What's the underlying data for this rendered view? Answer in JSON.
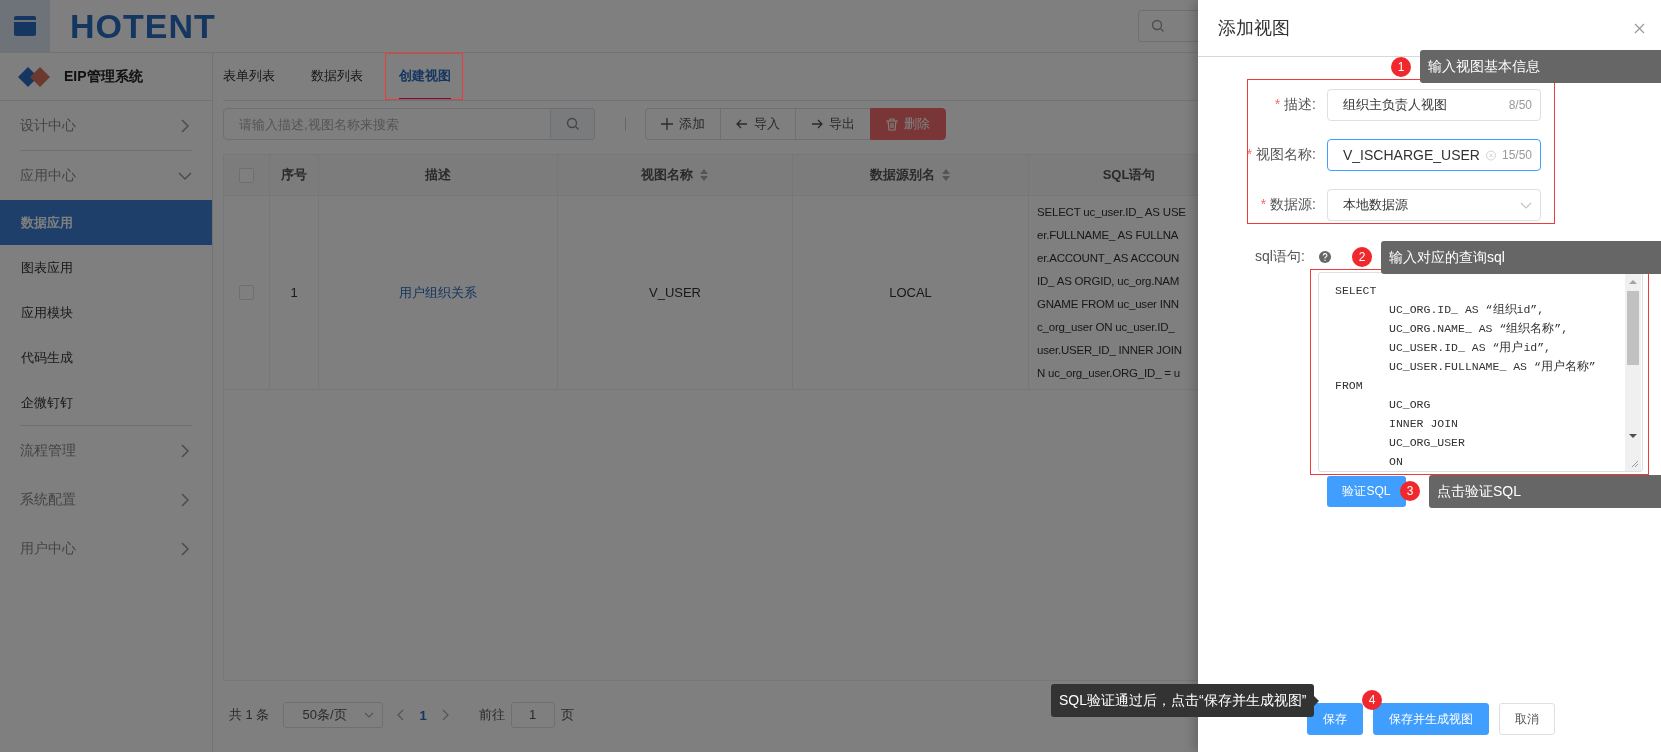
{
  "header": {
    "logo": "HOTENT"
  },
  "sidebar": {
    "title": "EIP管理系统",
    "items": [
      {
        "label": "设计中心",
        "expanded": false
      },
      {
        "label": "应用中心",
        "expanded": true,
        "children": [
          {
            "label": "数据应用",
            "selected": true
          },
          {
            "label": "图表应用",
            "selected": false
          },
          {
            "label": "应用模块",
            "selected": false
          },
          {
            "label": "代码生成",
            "selected": false
          },
          {
            "label": "企微钉钉",
            "selected": false
          }
        ]
      },
      {
        "label": "流程管理",
        "expanded": false
      },
      {
        "label": "系统配置",
        "expanded": false
      },
      {
        "label": "用户中心",
        "expanded": false
      }
    ]
  },
  "tabs": [
    {
      "label": "表单列表",
      "selected": false
    },
    {
      "label": "数据列表",
      "selected": false
    },
    {
      "label": "创建视图",
      "selected": true
    }
  ],
  "search": {
    "placeholder": "请输入描述,视图名称来搜索"
  },
  "toolbar": [
    {
      "label": "添加",
      "kind": "add"
    },
    {
      "label": "导入",
      "kind": "import"
    },
    {
      "label": "导出",
      "kind": "export"
    },
    {
      "label": "删除",
      "kind": "delete"
    }
  ],
  "table": {
    "all_checked": false,
    "columns": [
      {
        "label": "序号",
        "sortable": false
      },
      {
        "label": "描述",
        "sortable": false
      },
      {
        "label": "视图名称",
        "sortable": true
      },
      {
        "label": "数据源别名",
        "sortable": true
      },
      {
        "label": "SQL语句",
        "sortable": false
      }
    ],
    "rows": [
      {
        "checked": false,
        "cells": [
          {
            "kind": "text",
            "text": "1"
          },
          {
            "kind": "link",
            "text": "用户组织关系"
          },
          {
            "kind": "text",
            "text": "V_USER"
          },
          {
            "kind": "text",
            "text": "LOCAL"
          },
          {
            "kind": "lines",
            "lines": [
              "SELECT uc_user.ID_ AS USE",
              "er.FULLNAME_ AS FULLNA",
              "er.ACCOUNT_ AS ACCOUN",
              "ID_ AS ORGID, uc_org.NAM",
              "GNAME FROM uc_user INN",
              "c_org_user ON uc_user.ID_",
              "user.USER_ID_ INNER JOIN",
              "N uc_org_user.ORG_ID_ = u"
            ]
          }
        ]
      }
    ]
  },
  "pagination": {
    "total": "共 1 条",
    "page_size": "50条/页",
    "pages": [
      {
        "label": "1",
        "selected": true
      }
    ],
    "goto_label": "前往",
    "goto_value": "1",
    "goto_suffix": "页"
  },
  "dialog": {
    "title": "添加视图",
    "fields": [
      {
        "kind": "input",
        "label": "描述:",
        "required_mark": "*",
        "value": "组织主负责人视图",
        "count": "8/50",
        "focused": false,
        "clearable": false
      },
      {
        "kind": "input",
        "label": "视图名称:",
        "required_mark": "*",
        "value": "V_ISCHARGE_USER",
        "count": "15/50",
        "focused": true,
        "clearable": true
      },
      {
        "kind": "select",
        "label": "数据源:",
        "required_mark": "*",
        "value": "本地数据源"
      }
    ],
    "sql": {
      "label": "sql语句:",
      "lines": [
        {
          "text": "SELECT",
          "children": [
            {
              "text": "UC_ORG.ID_ AS “组织id”,"
            },
            {
              "text": "UC_ORG.NAME_ AS “组织名称”,"
            },
            {
              "text": "UC_USER.ID_ AS “用户id”,"
            },
            {
              "text": "UC_USER.FULLNAME_ AS “用户名称”"
            }
          ]
        },
        {
          "text": "FROM",
          "children": [
            {
              "text": "UC_ORG"
            },
            {
              "text": "INNER JOIN"
            },
            {
              "text": "UC_ORG_USER"
            },
            {
              "text": "ON"
            }
          ]
        }
      ]
    },
    "verify_button": "验证SQL",
    "buttons": [
      {
        "label": "保存",
        "kind": "primary"
      },
      {
        "label": "保存并生成视图",
        "kind": "primary"
      },
      {
        "label": "取消",
        "kind": "default"
      }
    ]
  },
  "annotations": [
    {
      "number": "1",
      "text": "输入视图基本信息"
    },
    {
      "number": "2",
      "text": "输入对应的查询sql"
    },
    {
      "number": "3",
      "text": "点击验证SQL"
    },
    {
      "number": "4",
      "text": "SQL验证通过后，点击“保存并生成视图”"
    }
  ]
}
